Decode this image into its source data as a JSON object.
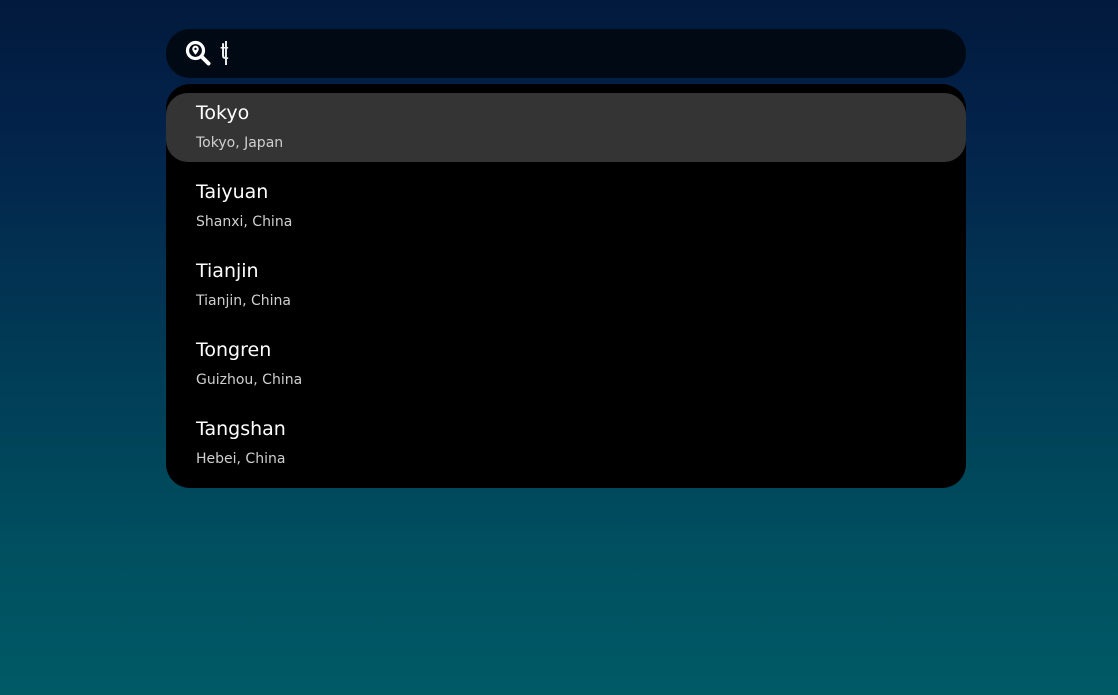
{
  "search": {
    "value": "t",
    "icon": "location-search-icon"
  },
  "results": [
    {
      "city": "Tokyo",
      "region": "Tokyo, Japan",
      "selected": true
    },
    {
      "city": "Taiyuan",
      "region": "Shanxi, China",
      "selected": false
    },
    {
      "city": "Tianjin",
      "region": "Tianjin, China",
      "selected": false
    },
    {
      "city": "Tongren",
      "region": "Guizhou, China",
      "selected": false
    },
    {
      "city": "Tangshan",
      "region": "Hebei, China",
      "selected": false
    }
  ],
  "colors": {
    "background_top": "#021a3d",
    "background_bottom": "#005a66",
    "search_bg": "#010a14",
    "list_bg": "#000000",
    "selected_bg": "#343434"
  }
}
